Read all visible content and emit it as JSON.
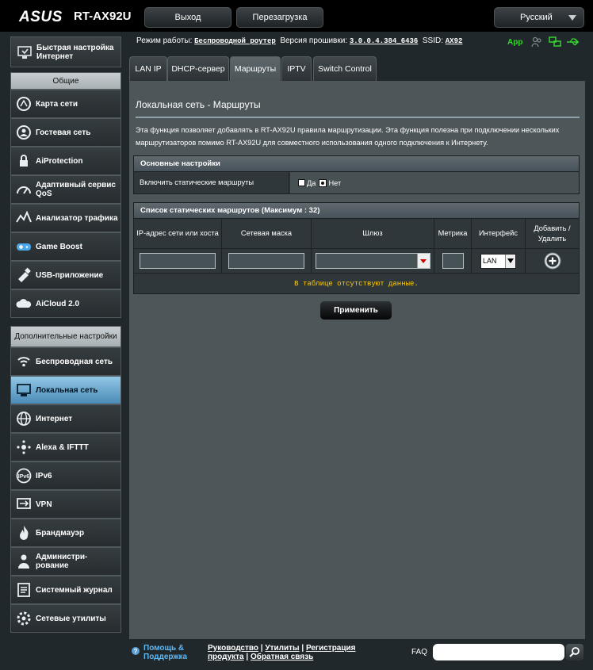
{
  "header": {
    "brand": "ASUS",
    "model": "RT-AX92U",
    "logout_label": "Выход",
    "reboot_label": "Перезагрузка",
    "language": "Русский"
  },
  "status": {
    "mode_label": "Режим работы:",
    "mode_value": "Беспроводной роутер",
    "fw_label": "Версия прошивки:",
    "fw_value": "3.0.0.4.384_6436",
    "ssid_label": "SSID:",
    "ssid_value": "AX92",
    "app_label": "App"
  },
  "sidebar": {
    "quick_setup": "Быстрая настройка Интернет",
    "general_heading": "Общие",
    "general_items": [
      {
        "label": "Карта сети",
        "icon": "network-map-icon"
      },
      {
        "label": "Гостевая сеть",
        "icon": "guest-network-icon"
      },
      {
        "label": "AiProtection",
        "icon": "aiprotection-icon"
      },
      {
        "label": "Адаптивный сервис QoS",
        "icon": "qos-icon"
      },
      {
        "label": "Анализатор трафика",
        "icon": "traffic-analyzer-icon"
      },
      {
        "label": "Game Boost",
        "icon": "game-boost-icon"
      },
      {
        "label": "USB-приложение",
        "icon": "usb-app-icon"
      },
      {
        "label": "AiCloud 2.0",
        "icon": "aicloud-icon"
      }
    ],
    "advanced_heading": "Дополнительные настройки",
    "advanced_items": [
      {
        "label": "Беспроводная сеть",
        "icon": "wireless-icon"
      },
      {
        "label": "Локальная сеть",
        "icon": "lan-icon"
      },
      {
        "label": "Интернет",
        "icon": "wan-icon"
      },
      {
        "label": "Alexa & IFTTT",
        "icon": "alexa-icon"
      },
      {
        "label": "IPv6",
        "icon": "ipv6-icon"
      },
      {
        "label": "VPN",
        "icon": "vpn-icon"
      },
      {
        "label": "Брандмауэр",
        "icon": "firewall-icon"
      },
      {
        "label": "Администри- рование",
        "icon": "admin-icon"
      },
      {
        "label": "Системный журнал",
        "icon": "syslog-icon"
      },
      {
        "label": "Сетевые утилиты",
        "icon": "network-tools-icon"
      }
    ],
    "active_item": "Локальная сеть"
  },
  "tabs": [
    "LAN IP",
    "DHCP-сервер",
    "Маршруты",
    "IPTV",
    "Switch Control"
  ],
  "active_tab": "Маршруты",
  "main": {
    "title": "Локальная сеть - Маршруты",
    "description": "Эта функция позволяет добавлять в RT-AX92U правила маршрутизации. Эта функция полезна при подключении нескольких маршрутизаторов помимо RT-AX92U для совместного использования одного подключения к Интернету.",
    "basic_heading": "Основные настройки",
    "static_label": "Включить статические маршруты",
    "yes_label": "Да",
    "no_label": "Нет",
    "static_enabled": "Нет",
    "list_heading": "Список статических маршрутов (Максимум : 32)",
    "columns": [
      "IP-адрес сети или хоста",
      "Сетевая маска",
      "Шлюз",
      "Метрика",
      "Интерфейс",
      "Добавить / Удалить"
    ],
    "ip_value": "",
    "mask_value": "",
    "gateway_value": "",
    "metric_value": "",
    "interface_value": "LAN",
    "empty_message": "В таблице отсутствуют данные.",
    "apply_label": "Применить"
  },
  "footer": {
    "help_label": "Помощь & Поддержка",
    "manual": "Руководство",
    "utility": "Утилиты",
    "registration": "Регистрация продукта",
    "feedback": "Обратная связь",
    "faq_label": "FAQ",
    "faq_value": ""
  },
  "colors": {
    "accent_active": "#6fa9cf",
    "empty_text": "#ffcc00",
    "app_green": "#36d22e"
  }
}
